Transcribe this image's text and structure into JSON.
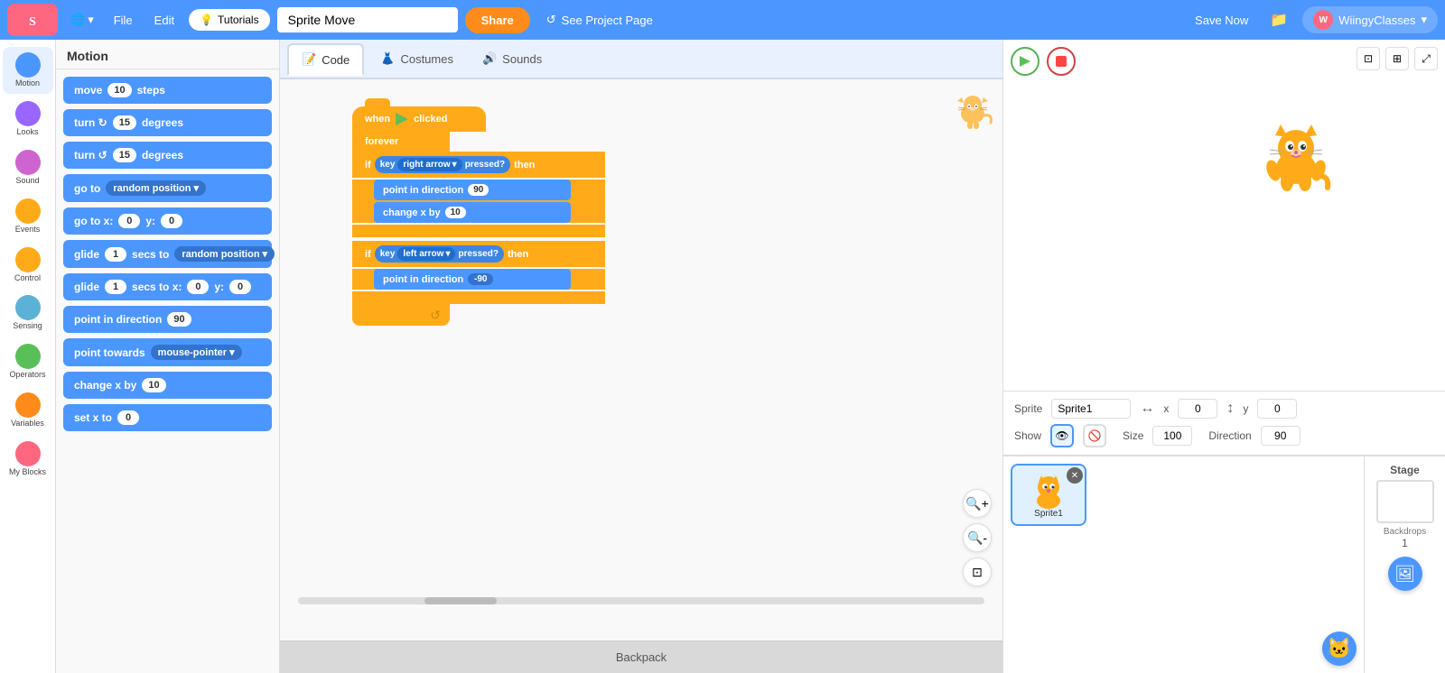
{
  "app": {
    "logo": "SCRATCH",
    "project_name": "Sprite Move",
    "share_label": "Share",
    "see_project_label": "See Project Page",
    "save_now_label": "Save Now",
    "username": "WiingyClasses"
  },
  "tabs": {
    "code_label": "Code",
    "costumes_label": "Costumes",
    "sounds_label": "Sounds"
  },
  "categories": [
    {
      "id": "motion",
      "label": "Motion",
      "color": "#4c97ff"
    },
    {
      "id": "looks",
      "label": "Looks",
      "color": "#9966ff"
    },
    {
      "id": "sound",
      "label": "Sound",
      "color": "#cf63cf"
    },
    {
      "id": "events",
      "label": "Events",
      "color": "#ffab19"
    },
    {
      "id": "control",
      "label": "Control",
      "color": "#ffab19"
    },
    {
      "id": "sensing",
      "label": "Sensing",
      "color": "#5cb1d6"
    },
    {
      "id": "operators",
      "label": "Operators",
      "color": "#59c059"
    },
    {
      "id": "variables",
      "label": "Variables",
      "color": "#ff8c1a"
    },
    {
      "id": "my_blocks",
      "label": "My Blocks",
      "color": "#ff6680"
    }
  ],
  "blocks": {
    "header": "Motion",
    "items": [
      {
        "label": "move",
        "value": "10",
        "suffix": "steps"
      },
      {
        "label": "turn ↻",
        "value": "15",
        "suffix": "degrees"
      },
      {
        "label": "turn ↺",
        "value": "15",
        "suffix": "degrees"
      },
      {
        "label": "go to",
        "dropdown": "random position"
      },
      {
        "label": "go to x:",
        "x": "0",
        "y_label": "y:",
        "y": "0"
      },
      {
        "label": "glide",
        "value": "1",
        "mid": "secs to",
        "dropdown": "random position"
      },
      {
        "label": "glide",
        "value": "1",
        "mid": "secs to x:",
        "x": "0",
        "y_label": "y:",
        "y": "0"
      },
      {
        "label": "point in direction",
        "value": "90"
      },
      {
        "label": "point towards",
        "dropdown": "mouse-pointer"
      },
      {
        "label": "change x by",
        "value": "10"
      },
      {
        "label": "set x to",
        "value": "0"
      }
    ]
  },
  "script": {
    "hat": "when 🏁 clicked",
    "forever": "forever",
    "if1_key": "right arrow",
    "if1_pressed": "pressed?",
    "if1_then": "then",
    "if1_direction_label": "point in direction",
    "if1_direction_value": "90",
    "if1_changex_label": "change x by",
    "if1_changex_value": "10",
    "if2_key": "left arrow",
    "if2_pressed": "pressed?",
    "if2_then": "then",
    "if2_direction_label": "point in direction",
    "if2_direction_value": "-90",
    "key_label": "key"
  },
  "sprite_info": {
    "sprite_label": "Sprite",
    "sprite_name": "Sprite1",
    "x_label": "x",
    "x_value": "0",
    "y_label": "y",
    "y_value": "0",
    "show_label": "Show",
    "size_label": "Size",
    "size_value": "100",
    "direction_label": "Direction",
    "direction_value": "90"
  },
  "sprite_list": {
    "sprites": [
      {
        "name": "Sprite1",
        "active": true
      }
    ]
  },
  "stage_section": {
    "label": "Stage",
    "backdrops_label": "Backdrops",
    "backdrops_count": "1"
  },
  "backpack": {
    "label": "Backpack"
  },
  "colors": {
    "motion_blue": "#4c97ff",
    "orange": "#ffab19",
    "green_flag": "#59c059",
    "stop_red": "#ff4444",
    "nav_blue": "#4c97ff"
  }
}
